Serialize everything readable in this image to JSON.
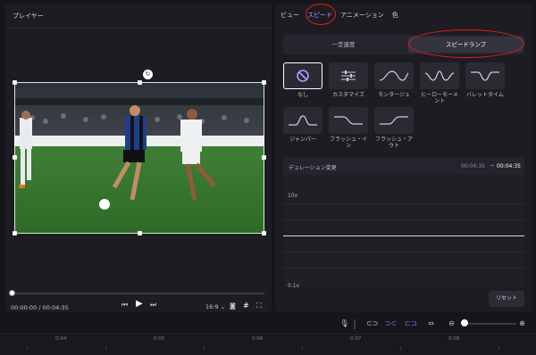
{
  "player": {
    "title": "プレイヤー",
    "timecode": "00:00:00 / 00:04:35",
    "ratio": "16:9 ⌄"
  },
  "tabs": [
    "ビュー",
    "スピード",
    "アニメーション",
    "色"
  ],
  "active_tab": "スピード",
  "speed_mode": {
    "normal_label": "一定速度",
    "ramp_label": "スピードランプ"
  },
  "presets": [
    {
      "label": "なし",
      "icon": "none-icon"
    },
    {
      "label": "カスタマイズ",
      "icon": "sliders-icon"
    },
    {
      "label": "モンタージュ",
      "icon": "montage-curve-icon"
    },
    {
      "label": "ヒーローモーメント",
      "icon": "hero-curve-icon"
    },
    {
      "label": "バレットタイム",
      "icon": "bullet-curve-icon"
    },
    {
      "label": "ジャンパー",
      "icon": "jumper-curve-icon"
    },
    {
      "label": "フラッシュ・イン",
      "icon": "flash-in-curve-icon"
    },
    {
      "label": "フラッシュ・アウト",
      "icon": "flash-out-curve-icon"
    }
  ],
  "duration": {
    "label": "デュレーション変更",
    "from": "00:04:35",
    "arrow": "→",
    "to": "00:04:35"
  },
  "curve": {
    "top_label": "10x",
    "bottom_label": "0.1x"
  },
  "reset_label": "リセット",
  "ruler_ticks": [
    "0:04",
    "0:05",
    "0:06",
    "0:07",
    "0:08"
  ],
  "colors": {
    "highlight_circle": "#e01e1e",
    "accent_purple": "#8b6cf7"
  }
}
